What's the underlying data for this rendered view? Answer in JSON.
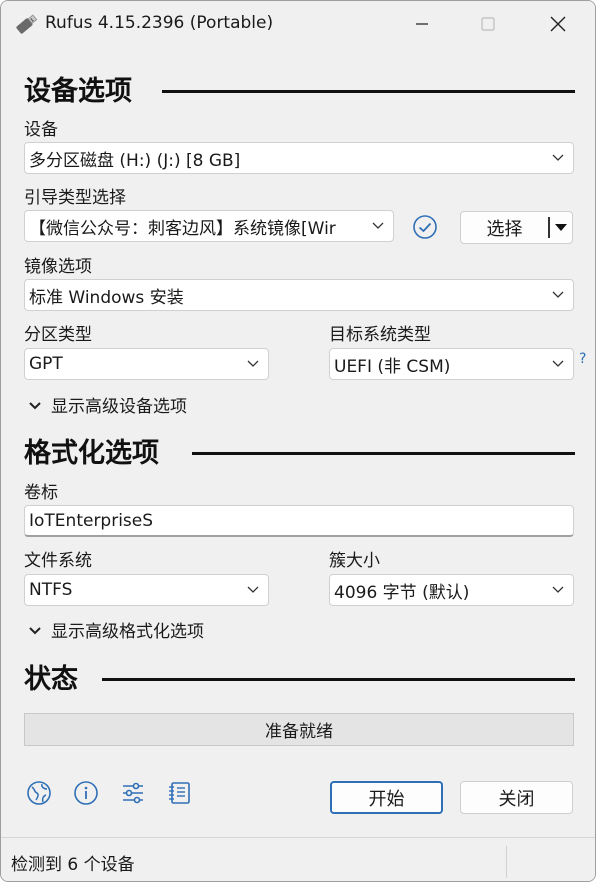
{
  "window": {
    "title": "Rufus 4.15.2396 (Portable)"
  },
  "device_options": {
    "section_title": "设备选项",
    "device_label": "设备",
    "device_value": "多分区磁盘 (H:) (J:) [8 GB]",
    "boot_label": "引导类型选择",
    "boot_value": "【微信公众号：刺客边风】系统镜像[Wir",
    "select_button": "选择",
    "image_option_label": "镜像选项",
    "image_option_value": "标准 Windows 安装",
    "partition_label": "分区类型",
    "partition_value": "GPT",
    "target_label": "目标系统类型",
    "target_value": "UEFI (非 CSM)",
    "help_mark": "?",
    "advanced_toggle": "显示高级设备选项"
  },
  "format_options": {
    "section_title": "格式化选项",
    "volume_label": "卷标",
    "volume_value": "IoTEnterpriseS",
    "fs_label": "文件系统",
    "fs_value": "NTFS",
    "cluster_label": "簇大小",
    "cluster_value": "4096 字节 (默认)",
    "advanced_toggle": "显示高级格式化选项"
  },
  "status": {
    "section_title": "状态",
    "text": "准备就绪"
  },
  "toolbar": {
    "icons": [
      "globe-icon",
      "info-icon",
      "settings-sliders-icon",
      "log-icon"
    ],
    "start_button": "开始",
    "close_button": "关闭"
  },
  "footer": {
    "text": "检测到 6 个设备"
  },
  "colors": {
    "accent": "#2f6fb6",
    "background": "#f0f0f0"
  }
}
